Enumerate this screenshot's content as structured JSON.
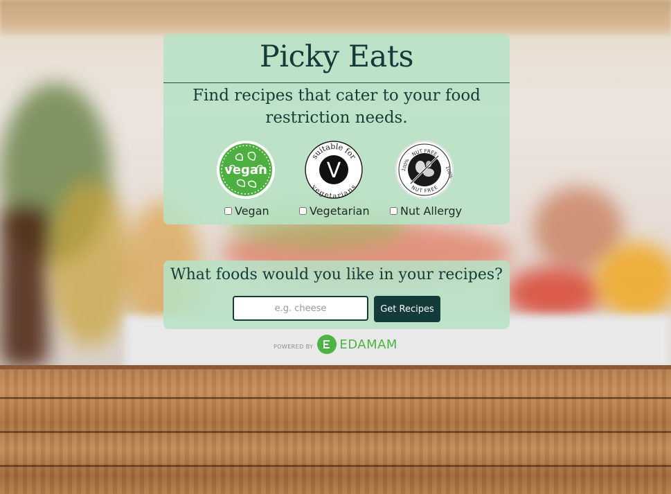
{
  "header": {
    "title": "Picky Eats",
    "tagline": "Find recipes that cater to your food restriction needs."
  },
  "restrictions": [
    {
      "label": "Vegan",
      "icon": "vegan-badge-icon",
      "checked": false
    },
    {
      "label": "Vegetarian",
      "icon": "vegetarian-badge-icon",
      "checked": false
    },
    {
      "label": "Nut Allergy",
      "icon": "nut-free-badge-icon",
      "checked": false
    }
  ],
  "badges": {
    "vegan_text": "vegan",
    "vegetarian_ring_top": "suitable for",
    "vegetarian_ring_bottom": "vegetarians",
    "vegetarian_mark": "V",
    "nut_ring_top": "NUT FREE",
    "nut_ring_bottom": "NUT FREE",
    "nut_side_left": "100%",
    "nut_side_right": "100%"
  },
  "search": {
    "question": "What foods would you like in your recipes?",
    "placeholder": "e.g. cheese",
    "value": "",
    "button_label": "Get Recipes"
  },
  "footer": {
    "powered_by": "POWERED BY",
    "brand": "EDAMAM"
  },
  "colors": {
    "panel": "#b7e2c5",
    "text_dark": "#133b39",
    "button": "#133b39",
    "vegan_green": "#4caf3f",
    "edamam_green": "#4cb344"
  }
}
